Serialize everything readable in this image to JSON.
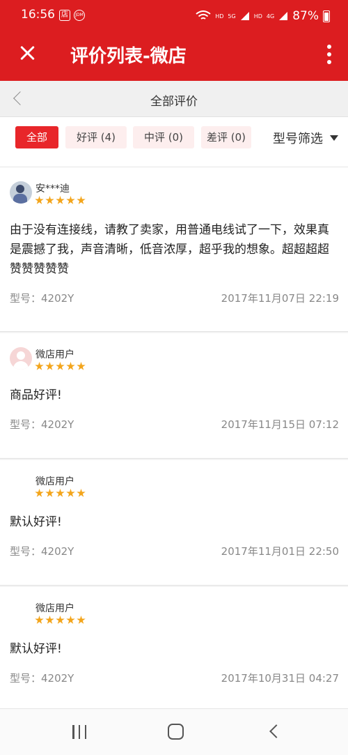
{
  "status_bar": {
    "time": "16:56",
    "app_icon_1": "店",
    "app_icon_2": "JDM",
    "net_label_1": "HD",
    "net_label_2": "5G",
    "net_label_3": "HD",
    "net_label_4": "4G",
    "battery": "87%"
  },
  "header": {
    "title": "评价列表-微店"
  },
  "subnav": {
    "title": "全部评价"
  },
  "filters": {
    "chips": [
      {
        "label": "全部",
        "active": true
      },
      {
        "label": "好评 (4)",
        "active": false
      },
      {
        "label": "中评 (0)",
        "active": false
      },
      {
        "label": "差评 (0)",
        "active": false
      }
    ],
    "model_filter": "型号筛选"
  },
  "reviews": [
    {
      "user": "安***迪",
      "stars": 5,
      "content": "由于没有连接线，请教了卖家，用普通电线试了一下，效果真是震撼了我，声音清晰，低音浓厚，超乎我的想象。超超超超赞赞赞赞赞",
      "model": "型号：4202Y",
      "date": "2017年11月07日 22:19"
    },
    {
      "user": "微店用户",
      "stars": 5,
      "content": "商品好评!",
      "model": "型号：4202Y",
      "date": "2017年11月15日 07:12"
    },
    {
      "user": "微店用户",
      "stars": 5,
      "content": "默认好评!",
      "model": "型号：4202Y",
      "date": "2017年11月01日 22:50"
    },
    {
      "user": "微店用户",
      "stars": 5,
      "content": "默认好评!",
      "model": "型号：4202Y",
      "date": "2017年10月31日 04:27"
    }
  ],
  "colors": {
    "brand_red": "#dc1d20",
    "chip_active": "#e8262a",
    "star": "#f3a51c"
  },
  "icons": [
    "close-icon",
    "more-vert-icon",
    "chevron-left-icon",
    "caret-down-icon",
    "wifi-icon",
    "signal-icon",
    "battery-icon"
  ]
}
